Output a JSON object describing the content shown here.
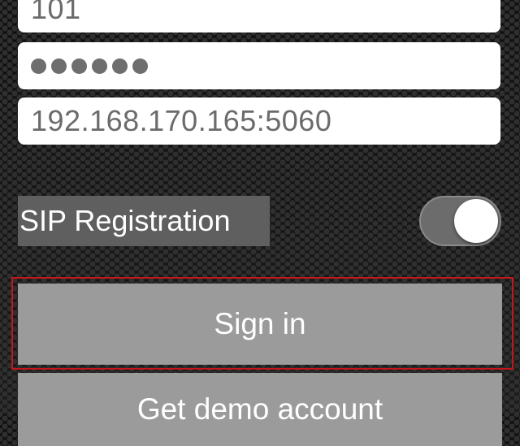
{
  "login_form": {
    "username_value": "101",
    "password_dot_count": 6,
    "server_value": "192.168.170.165:5060"
  },
  "sip_registration": {
    "label": "SIP Registration",
    "enabled": true
  },
  "buttons": {
    "sign_in_label": "Sign in",
    "demo_label": "Get demo account"
  },
  "colors": {
    "highlight_border": "#c4161c",
    "button_bg": "#9b9b9b",
    "label_bg": "#5f5f5f"
  }
}
